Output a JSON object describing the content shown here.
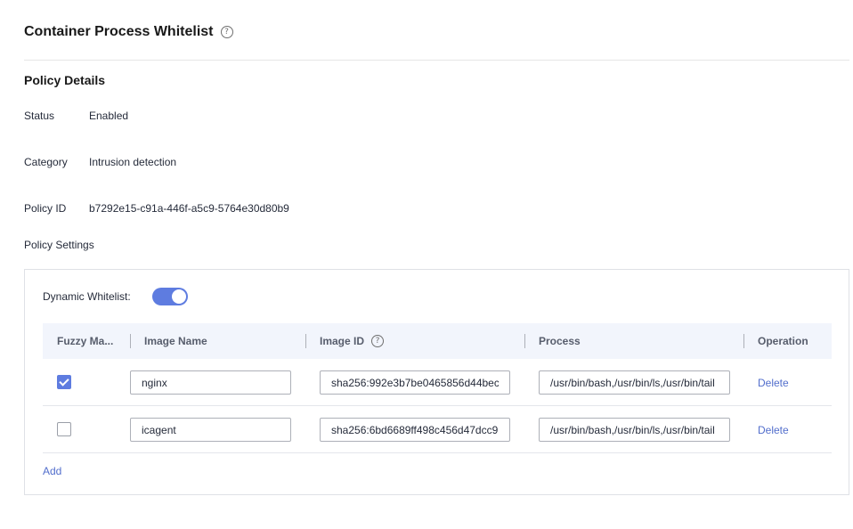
{
  "header": {
    "title": "Container Process Whitelist",
    "help_glyph": "?"
  },
  "policy_details": {
    "title": "Policy Details",
    "status": {
      "label": "Status",
      "value": "Enabled"
    },
    "category": {
      "label": "Category",
      "value": "Intrusion detection"
    },
    "policy_id": {
      "label": "Policy ID",
      "value": "b7292e15-c91a-446f-a5c9-5764e30d80b9"
    }
  },
  "policy_settings": {
    "label": "Policy Settings",
    "dynamic_whitelist": {
      "label": "Dynamic Whitelist:",
      "enabled": true
    },
    "table": {
      "columns": {
        "fuzzy_match": "Fuzzy Ma...",
        "image_name": "Image Name",
        "image_id": "Image ID",
        "process": "Process",
        "operation": "Operation"
      },
      "rows": [
        {
          "fuzzy_match": true,
          "image_name": "nginx",
          "image_id": "sha256:992e3b7be0465856d44bec",
          "process": "/usr/bin/bash,/usr/bin/ls,/usr/bin/tail",
          "operation": "Delete"
        },
        {
          "fuzzy_match": false,
          "image_name": "icagent",
          "image_id": "sha256:6bd6689ff498c456d47dcc9",
          "process": "/usr/bin/bash,/usr/bin/ls,/usr/bin/tail",
          "operation": "Delete"
        }
      ]
    },
    "add_label": "Add"
  },
  "colors": {
    "accent": "#5e7ce0",
    "link": "#526ecc",
    "header_bg": "#f2f5fc"
  }
}
